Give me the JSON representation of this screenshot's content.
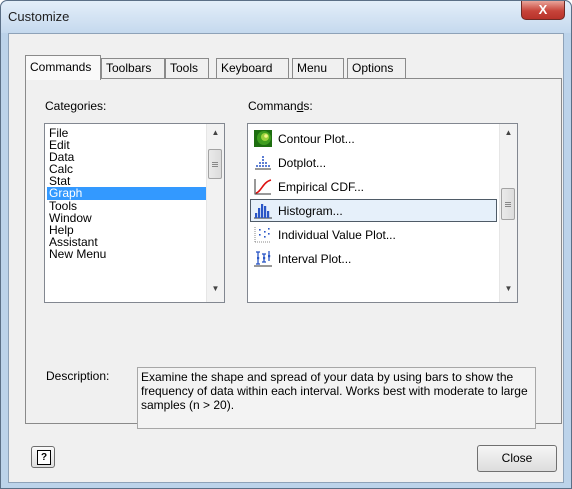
{
  "window": {
    "title": "Customize",
    "close_glyph": "X"
  },
  "tabs": [
    {
      "label": "Commands",
      "active": true
    },
    {
      "label": "Toolbars",
      "active": false
    },
    {
      "label": "Tools",
      "active": false
    },
    {
      "label": "Keyboard",
      "active": false
    },
    {
      "label": "Menu",
      "active": false
    },
    {
      "label": "Options",
      "active": false
    }
  ],
  "categories": {
    "label_before": "Cate",
    "label_mnemonic": "g",
    "label_after": "ories:",
    "items": [
      "File",
      "Edit",
      "Data",
      "Calc",
      "Stat",
      "Graph",
      "Tools",
      "Window",
      "Help",
      "Assistant",
      "New Menu"
    ],
    "selected": "Graph"
  },
  "commands": {
    "label_before": "Comman",
    "label_mnemonic": "d",
    "label_after": "s:",
    "items": [
      {
        "label": "Contour Plot...",
        "icon": "contour-plot-icon"
      },
      {
        "label": "Dotplot...",
        "icon": "dotplot-icon"
      },
      {
        "label": "Empirical CDF...",
        "icon": "empirical-cdf-icon"
      },
      {
        "label": "Histogram...",
        "icon": "histogram-icon",
        "selected": true
      },
      {
        "label": "Individual Value Plot...",
        "icon": "individual-value-plot-icon"
      },
      {
        "label": "Interval Plot...",
        "icon": "interval-plot-icon"
      }
    ]
  },
  "description": {
    "label": "Description:",
    "text": "Examine the shape and spread of your data by using bars to show the frequency of data within each interval. Works best with moderate to large samples (n > 20)."
  },
  "footer": {
    "help_icon": "help-icon",
    "help_glyph": "?",
    "close_label": "Close"
  },
  "colors": {
    "selection": "#3399ff",
    "frame": "#bcd3ea",
    "close_red": "#c7443a"
  }
}
